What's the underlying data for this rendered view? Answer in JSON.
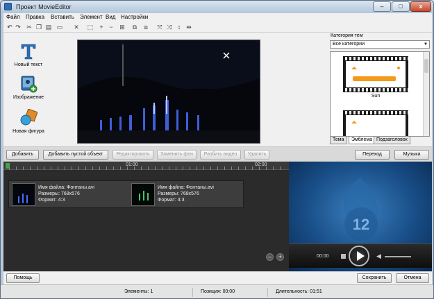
{
  "window": {
    "title": "Проект MovieEditor",
    "controls": [
      "–",
      "□",
      "x"
    ]
  },
  "menu": [
    "Файл",
    "Правка",
    "Вставить",
    "Элемент",
    "Вид",
    "Настройки"
  ],
  "toolbar_icons": [
    "undo-icon",
    "redo-icon",
    "cut-icon",
    "copy-icon",
    "paste-icon",
    "delete-icon",
    "crop-icon",
    "zoom-in-icon",
    "zoom-out-icon",
    "fit-icon",
    "group-icon",
    "ungroup-icon",
    "flip-icon",
    "rotate-icon",
    "align-icon",
    "distribute-icon"
  ],
  "tools": [
    {
      "label": "Новый текст",
      "icon": "text-icon"
    },
    {
      "label": "Изображение",
      "icon": "image-add-icon"
    },
    {
      "label": "Новая фигура",
      "icon": "shape-icon"
    }
  ],
  "themes": {
    "category_label": "Категория тем",
    "category_value": "Все категории",
    "items": [
      {
        "name": "Sun"
      },
      {
        "name": ""
      }
    ],
    "tabs": [
      "Тема",
      "Эмблема",
      "Подзаголовок"
    ]
  },
  "action_buttons": {
    "add": "Добавить",
    "add_empty": "Добавить пустой объект",
    "edit": "Редактировать",
    "replace": "Заменить фон",
    "split": "Разбить видео",
    "delete": "Удалить",
    "transition": "Переход",
    "music": "Музыка"
  },
  "timeline": {
    "marks": [
      "01:00",
      "02:00"
    ],
    "clips": [
      {
        "file": "Имя файла: Фонтаны.avi",
        "size": "Размеры: 768x576",
        "format": "Формат: 4:3"
      },
      {
        "file": "Имя файла: Фонтаны.avi",
        "size": "Размеры: 768x576",
        "format": "Формат: 4:3"
      }
    ],
    "zoom_out": "–",
    "zoom_in": "+"
  },
  "player": {
    "time": "00:00",
    "logo_number": "12"
  },
  "bottom_buttons": {
    "help": "Помощь",
    "save": "Сохранить",
    "cancel": "Отмена"
  },
  "status": {
    "elements": "Элементы: 1",
    "position": "Позиция: 00:00",
    "duration": "Длительность: 01:51"
  }
}
